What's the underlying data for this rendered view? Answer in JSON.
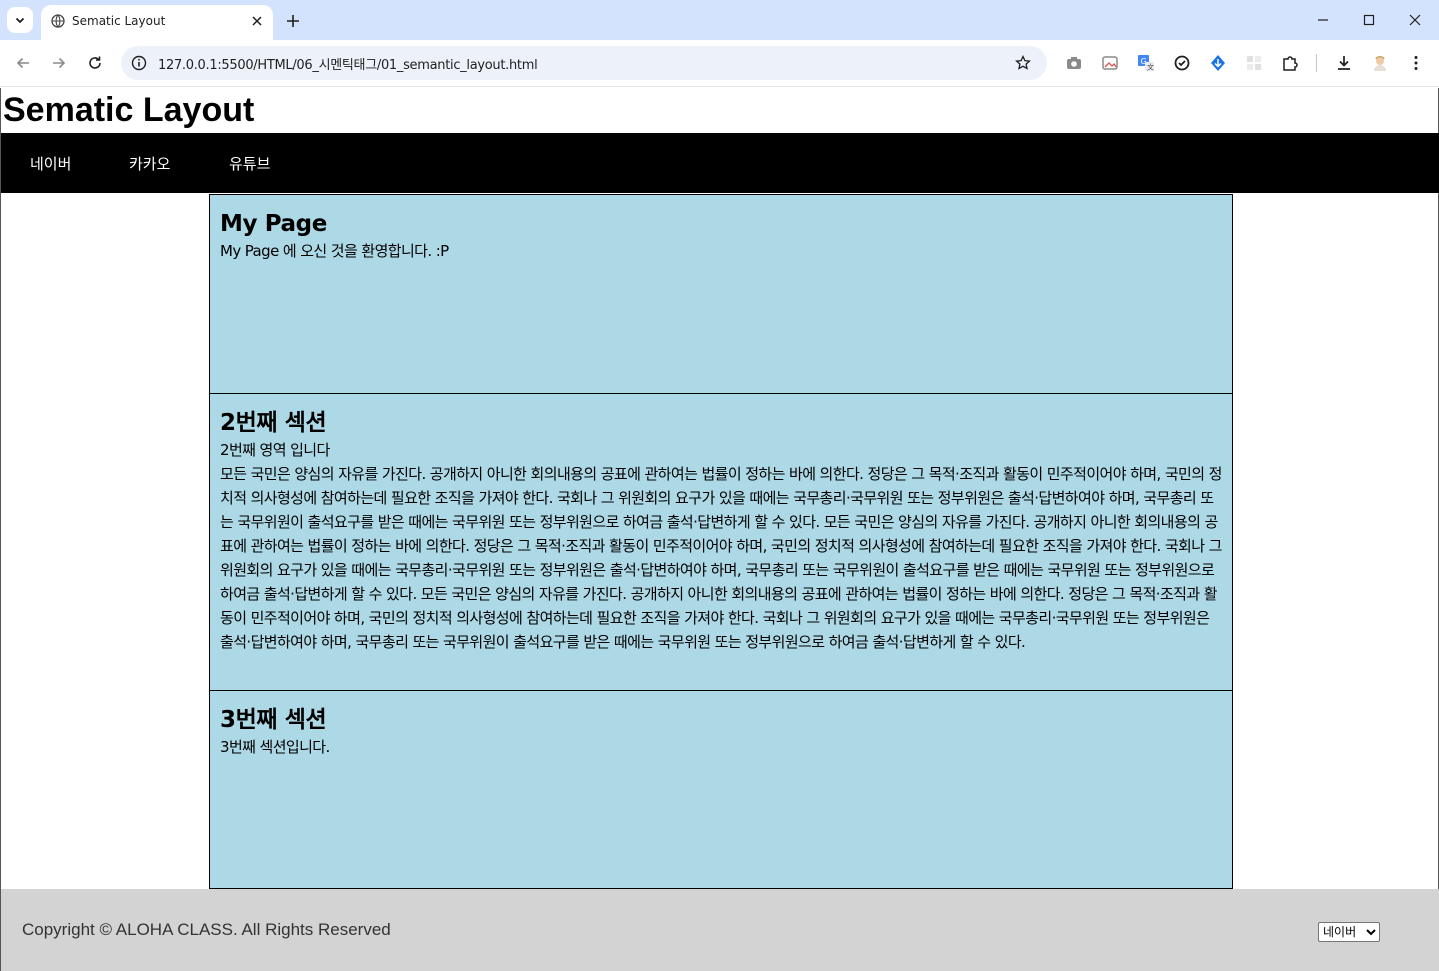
{
  "browser": {
    "tab_title": "Sematic Layout",
    "url": "127.0.0.1:5500/HTML/06_시멘틱태그/01_semantic_layout.html"
  },
  "header": {
    "title": "Sematic Layout",
    "nav": [
      {
        "label": "네이버"
      },
      {
        "label": "카카오"
      },
      {
        "label": "유튜브"
      }
    ]
  },
  "sections": [
    {
      "heading": "My Page",
      "text": "My Page 에 오신 것을 환영합니다. :P"
    },
    {
      "heading": "2번째 섹션",
      "subtext": "2번째 영역 입니다",
      "text": "모든 국민은 양심의 자유를 가진다. 공개하지 아니한 회의내용의 공표에 관하여는 법률이 정하는 바에 의한다. 정당은 그 목적·조직과 활동이 민주적이어야 하며, 국민의 정치적 의사형성에 참여하는데 필요한 조직을 가져야 한다. 국회나 그 위원회의 요구가 있을 때에는 국무총리·국무위원 또는 정부위원은 출석·답변하여야 하며, 국무총리 또는 국무위원이 출석요구를 받은 때에는 국무위원 또는 정부위원으로 하여금 출석·답변하게 할 수 있다. 모든 국민은 양심의 자유를 가진다. 공개하지 아니한 회의내용의 공표에 관하여는 법률이 정하는 바에 의한다. 정당은 그 목적·조직과 활동이 민주적이어야 하며, 국민의 정치적 의사형성에 참여하는데 필요한 조직을 가져야 한다. 국회나 그 위원회의 요구가 있을 때에는 국무총리·국무위원 또는 정부위원은 출석·답변하여야 하며, 국무총리 또는 국무위원이 출석요구를 받은 때에는 국무위원 또는 정부위원으로 하여금 출석·답변하게 할 수 있다. 모든 국민은 양심의 자유를 가진다. 공개하지 아니한 회의내용의 공표에 관하여는 법률이 정하는 바에 의한다. 정당은 그 목적·조직과 활동이 민주적이어야 하며, 국민의 정치적 의사형성에 참여하는데 필요한 조직을 가져야 한다. 국회나 그 위원회의 요구가 있을 때에는 국무총리·국무위원 또는 정부위원은 출석·답변하여야 하며, 국무총리 또는 국무위원이 출석요구를 받은 때에는 국무위원 또는 정부위원으로 하여금 출석·답변하게 할 수 있다."
    },
    {
      "heading": "3번째 섹션",
      "text": "3번째 섹션입니다."
    }
  ],
  "footer": {
    "copyright": "Copyright © ALOHA CLASS. All Rights Reserved",
    "select_value": "네이버"
  },
  "colors": {
    "section_bg": "#add8e6",
    "navbar_bg": "#000000",
    "footer_bg": "#d3d3d3",
    "chrome_bg": "#d3e3fd"
  }
}
